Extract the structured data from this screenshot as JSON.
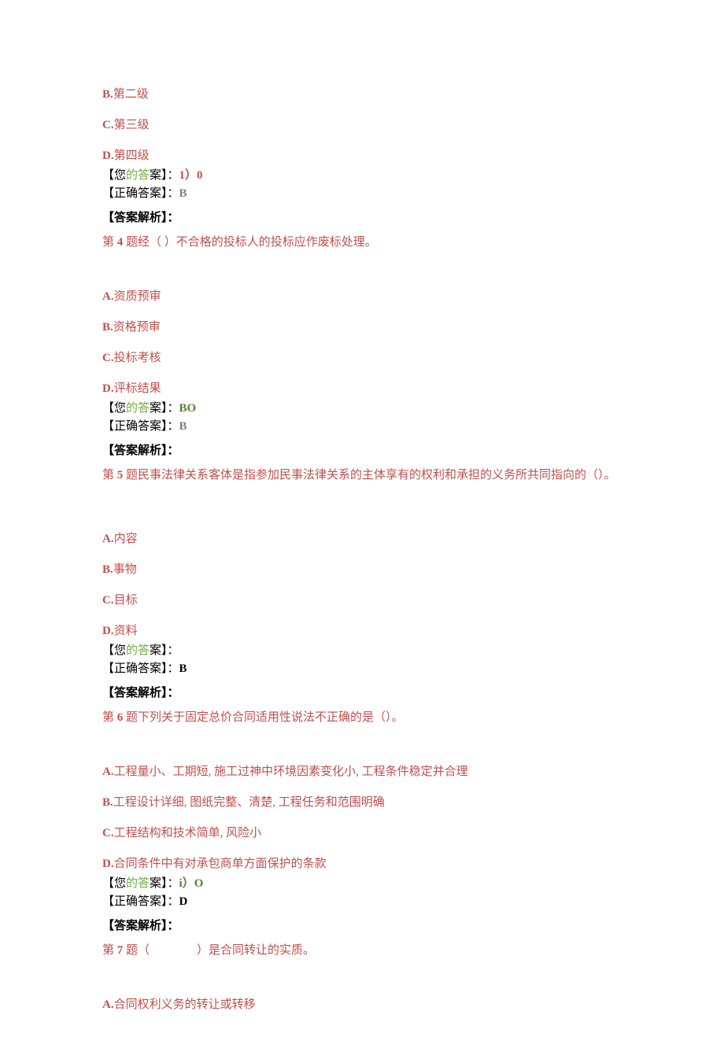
{
  "q3_tail": {
    "optB": {
      "letter": "B.",
      "text": "第二级"
    },
    "optC": {
      "letter": "C.",
      "text": "第三级"
    },
    "optD": {
      "letter": "D.",
      "text": "第四级"
    },
    "yourLabelPre": "【您",
    "yourLabelGreen": "的答",
    "yourLabelPost": "案】：",
    "yourVal": "1）0",
    "correctLabel": "【正确答案】：",
    "correctVal": "B",
    "analysisLabel": "【答案解析】："
  },
  "q4": {
    "qLabel": "第 4 题",
    "qText": "经（ ）不合格的投标人的投标应作废标处理。",
    "optA": {
      "letter": "A.",
      "text": "资质预审"
    },
    "optB": {
      "letter": "B.",
      "text": "资格预审"
    },
    "optC": {
      "letter": "C.",
      "text": "投标考核"
    },
    "optD": {
      "letter": "D.",
      "text": "评标结果"
    },
    "yourLabelPre": "【您",
    "yourLabelGreen": "的答",
    "yourLabelPost": "案】：",
    "yourVal": "BO",
    "correctLabel": "【正确答案】：",
    "correctVal": "B",
    "analysisLabel": "【答案解析】："
  },
  "q5": {
    "qLabel": "第 5 题",
    "qText": "民事法律关系客体是指参加民事法律关系的主体享有的权利和承担的义务所共同指向的（）。",
    "optA": {
      "letter": "A.",
      "text": "内容"
    },
    "optB": {
      "letter": "B.",
      "text": "事物"
    },
    "optC": {
      "letter": "C.",
      "text": "目标"
    },
    "optD": {
      "letter": "D.",
      "text": "资料"
    },
    "yourLabelPre": "【您",
    "yourLabelGreen": "的答",
    "yourLabelPost": "案】：",
    "yourVal": "",
    "correctLabel": "【正确答案】：",
    "correctVal": "B",
    "analysisLabel": "【答案解析】："
  },
  "q6": {
    "qLabel": "第 6 题",
    "qText": "下列关于固定总价合同适用性说法不正确的是（）。",
    "optA": {
      "letter": "A.",
      "text": "工程量小、工期短, 施工过神中环境因素变化小, 工程条件稳定并合理"
    },
    "optB": {
      "letter": "B.",
      "text": "工程设计详细, 图纸完整、清楚, 工程任务和范围明确"
    },
    "optC": {
      "letter": "C.",
      "text": "工程结构和技术简单, 风险小"
    },
    "optD": {
      "letter": "D.",
      "text": "合同条件中有对承包商单方面保护的条款"
    },
    "yourLabelPre": "【您",
    "yourLabelGreen": "的答",
    "yourLabelPost": "案】：",
    "yourVal": "i）O",
    "correctLabel": "【正确答案】：",
    "correctVal": "D",
    "analysisLabel": "【答案解析】："
  },
  "q7": {
    "qLabel": "第 7 题",
    "qText": "（　　　　）是合同转让的实质。",
    "optA": {
      "letter": "A.",
      "text": "合同权利义务的转让或转移"
    }
  }
}
